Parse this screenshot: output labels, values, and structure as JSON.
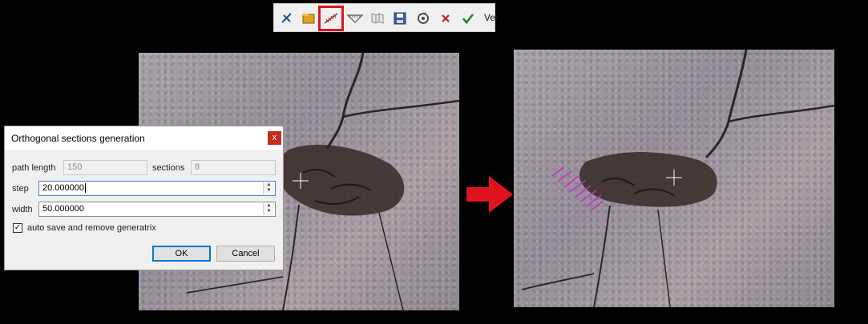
{
  "toolbar": {
    "tools": [
      {
        "name": "pick-tool-icon"
      },
      {
        "name": "import-polyline-icon"
      },
      {
        "name": "generate-orthogonal-sections-icon",
        "selected": true
      },
      {
        "name": "section-profile-icon"
      },
      {
        "name": "map-icon"
      },
      {
        "name": "save-icon"
      },
      {
        "name": "reset-icon"
      },
      {
        "name": "close-x-icon"
      },
      {
        "name": "confirm-check-icon"
      }
    ],
    "trailing_label": "Ver"
  },
  "dialog": {
    "title": "Orthogonal sections generation",
    "close_glyph": "x",
    "path_length_label": "path length",
    "path_length_value": "150",
    "sections_label": "sections",
    "sections_value": "8",
    "step_label": "step",
    "step_value": "20.000000",
    "width_label": "width",
    "width_value": "50.000000",
    "auto_save_label": "auto save and remove generatrix",
    "auto_save_checked": true,
    "ok_label": "OK",
    "cancel_label": "Cancel"
  },
  "colors": {
    "highlight": "#e0141e",
    "arrow": "#e0141e",
    "section_lines": "#d028d0"
  }
}
